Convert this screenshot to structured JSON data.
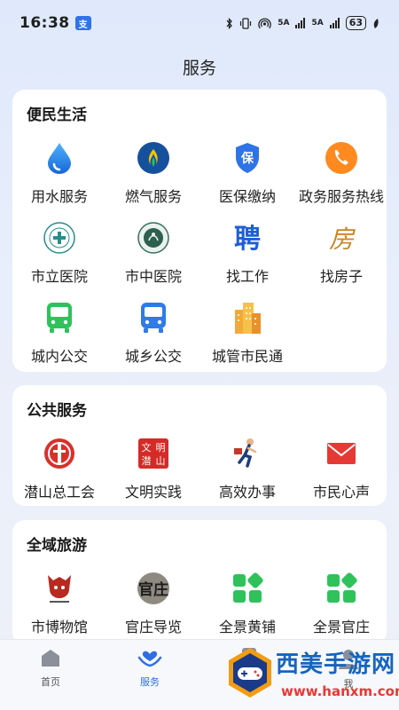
{
  "status": {
    "time": "16:38",
    "notif": "支",
    "net1": "5A",
    "net2": "5A",
    "battery": "63"
  },
  "title": "服务",
  "sections": [
    {
      "title": "便民生活",
      "items": [
        {
          "label": "用水服务",
          "icon": "water-drop-icon"
        },
        {
          "label": "燃气服务",
          "icon": "gas-flame-icon"
        },
        {
          "label": "医保缴纳",
          "icon": "medical-insurance-shield-icon",
          "glyph": "保"
        },
        {
          "label": "政务服务热线",
          "icon": "phone-hotline-icon"
        },
        {
          "label": "市立医院",
          "icon": "hospital-emblem-icon"
        },
        {
          "label": "市中医院",
          "icon": "tcm-hospital-emblem-icon"
        },
        {
          "label": "找工作",
          "icon": "job-hire-icon",
          "glyph": "聘"
        },
        {
          "label": "找房子",
          "icon": "house-search-icon",
          "glyph": "房"
        },
        {
          "label": "城内公交",
          "icon": "city-bus-icon"
        },
        {
          "label": "城乡公交",
          "icon": "rural-bus-icon"
        },
        {
          "label": "城管市民通",
          "icon": "city-buildings-icon"
        }
      ]
    },
    {
      "title": "公共服务",
      "items": [
        {
          "label": "潜山总工会",
          "icon": "trade-union-icon"
        },
        {
          "label": "文明实践",
          "icon": "civilization-practice-icon",
          "glyph": "文明潜山"
        },
        {
          "label": "高效办事",
          "icon": "running-man-icon"
        },
        {
          "label": "市民心声",
          "icon": "mail-envelope-icon"
        }
      ]
    },
    {
      "title": "全域旅游",
      "items": [
        {
          "label": "市博物馆",
          "icon": "museum-logo-icon"
        },
        {
          "label": "官庄导览",
          "icon": "guanzhuang-calligraphy-icon",
          "glyph": "官庄"
        },
        {
          "label": "全景黄铺",
          "icon": "panorama-grid-icon"
        },
        {
          "label": "全景官庄",
          "icon": "panorama-grid-icon"
        }
      ]
    }
  ],
  "tabs": [
    {
      "label": "首页",
      "icon": "home-icon"
    },
    {
      "label": "服务",
      "icon": "heart-hands-icon",
      "active": true
    },
    {
      "label": "",
      "icon": "phone-icon"
    },
    {
      "label": "我",
      "icon": "user-icon"
    }
  ],
  "watermark": {
    "title": "西美手游网",
    "url": "www.hanxm.com"
  },
  "colors": {
    "accent": "#2f6fe4",
    "green": "#2fc25b",
    "orange": "#ff8a1f",
    "red": "#d9302c"
  }
}
